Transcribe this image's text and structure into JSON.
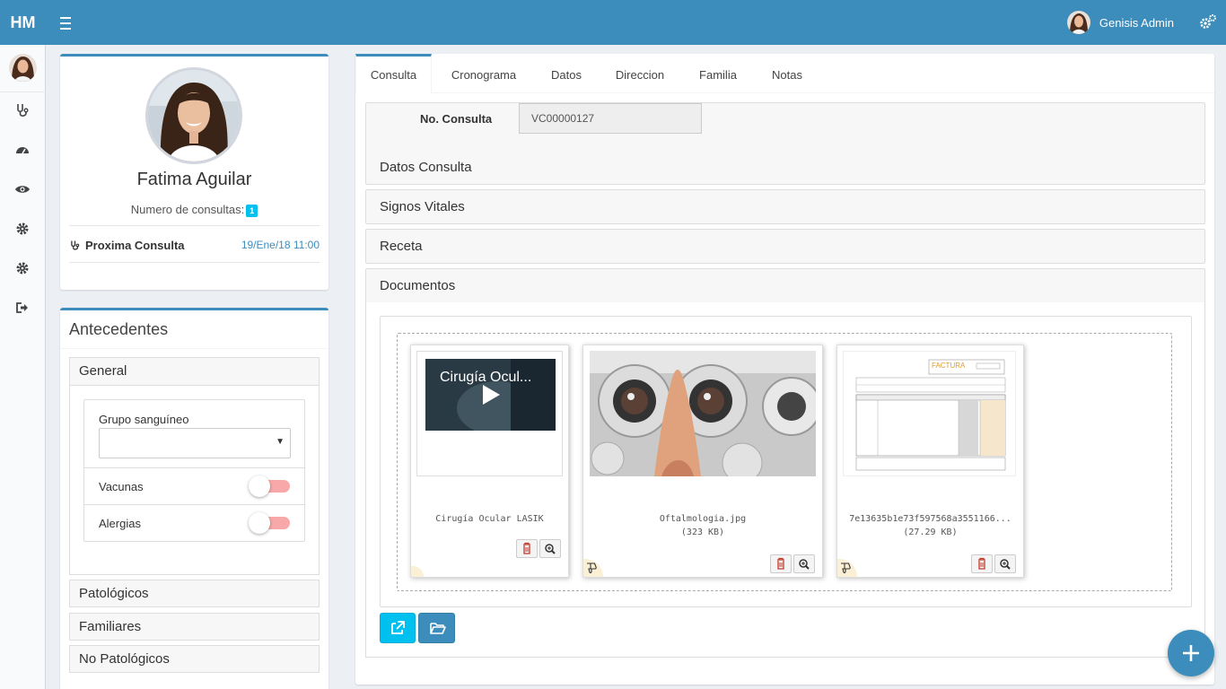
{
  "app": {
    "logo": "HM",
    "user_name": "Genisis Admin"
  },
  "profile": {
    "name": "Fatima Aguilar",
    "consult_count_label": "Numero de consultas:",
    "consult_count": "1",
    "next_label": "Proxima Consulta",
    "next_value": "19/Ene/18 11:00"
  },
  "antecedentes": {
    "title": "Antecedentes",
    "general": {
      "title": "General",
      "blood_label": "Grupo sanguíneo",
      "blood_value": "",
      "vaccines_label": "Vacunas",
      "allergies_label": "Alergias"
    },
    "others": [
      "Patológicos",
      "Familiares",
      "No Patológicos"
    ]
  },
  "tabs": [
    "Consulta",
    "Cronograma",
    "Datos",
    "Direccion",
    "Familia",
    "Notas"
  ],
  "consulta": {
    "no_label": "No. Consulta",
    "no_value": "VC00000127",
    "panels": {
      "datos": "Datos Consulta",
      "signos": "Signos Vitales",
      "receta": "Receta",
      "documentos": "Documentos"
    }
  },
  "documents": [
    {
      "caption": "Cirugía Ocular LASIK",
      "size": "",
      "video_title": "Cirugía Ocul..."
    },
    {
      "caption": "Oftalmologia.jpg",
      "size": "(323 KB)"
    },
    {
      "caption": "7e13635b1e73f597568a3551166...",
      "size": "(27.29 KB)",
      "invoice_title": "FACTURA"
    }
  ],
  "colors": {
    "primary": "#3c8dbc",
    "info": "#00c0ef",
    "toggle_off": "#f8a8a8"
  }
}
